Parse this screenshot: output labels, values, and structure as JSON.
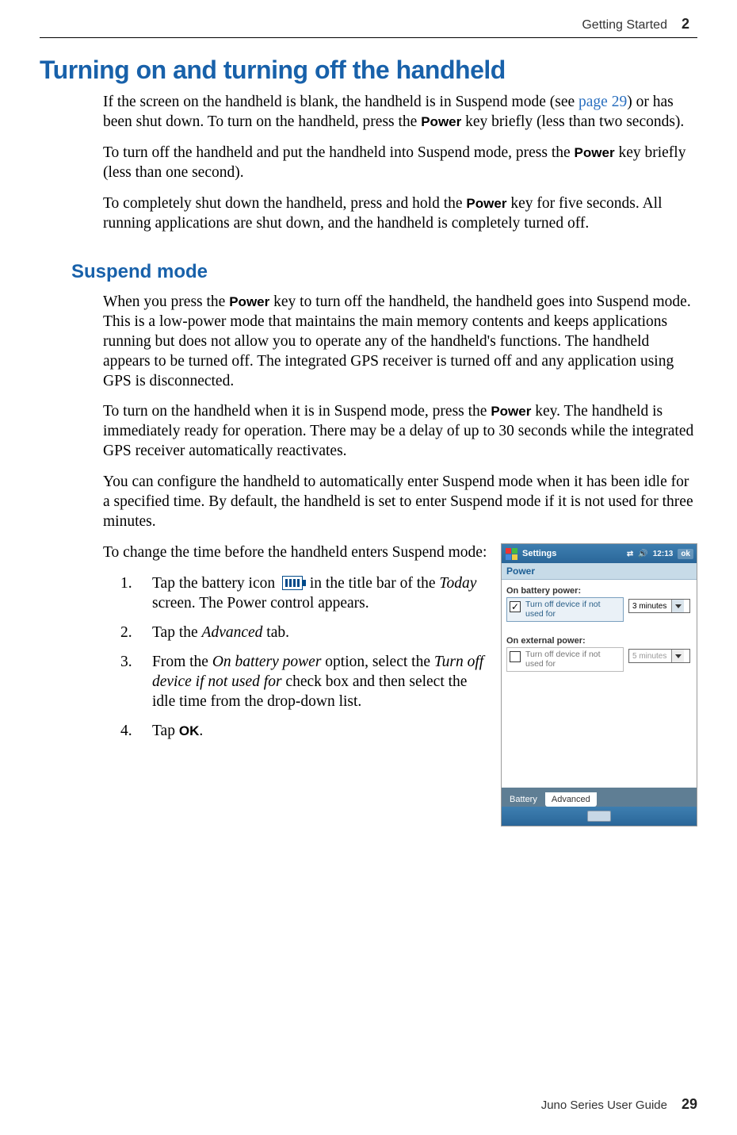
{
  "header": {
    "section": "Getting Started",
    "chapter": "2"
  },
  "h1": "Turning on and turning off the handheld",
  "para1": {
    "t1": "If the screen on the handheld is blank, the handheld is in Suspend mode (see ",
    "link": "page 29",
    "t2": ") or has been shut down. To turn on the handheld, press the ",
    "b1": "Power",
    "t3": " key briefly (less than two seconds)."
  },
  "para2": {
    "t1": "To turn off the handheld and put the handheld into Suspend mode, press the ",
    "b1": "Power",
    "t2": " key briefly (less than one second)."
  },
  "para3": {
    "t1": "To completely shut down the handheld, press and hold the ",
    "b1": "Power",
    "t2": " key for five seconds. All running applications are shut down, and the handheld is completely turned off."
  },
  "h2": "Suspend mode",
  "para4": {
    "t1": "When you press the ",
    "b1": "Power",
    "t2": " key to turn off the handheld, the handheld goes into Suspend mode. This is a low-power mode that maintains the main memory contents and keeps applications running but does not allow you to operate any of the handheld's functions. The handheld appears to be turned off. The integrated GPS receiver is turned off and any application using GPS is disconnected."
  },
  "para5": {
    "t1": "To turn on the handheld when it is in Suspend mode, press the ",
    "b1": "Power",
    "t2": " key. The handheld is immediately ready for operation. There may be a delay of up to 30 seconds while the integrated GPS receiver automatically reactivates."
  },
  "para6": "You can configure the handheld to automatically enter Suspend mode when it has been idle for a specified time. By default, the handheld is set to enter Suspend mode if it is not used for three minutes.",
  "para7": "To change the time before the handheld enters Suspend mode:",
  "steps": {
    "s1": {
      "t1": "Tap the battery icon ",
      "t2": " in the title bar of the ",
      "i1": "Today",
      "t3": " screen. The Power control appears."
    },
    "s2": {
      "t1": "Tap the ",
      "i1": "Advanced",
      "t2": " tab."
    },
    "s3": {
      "t1": "From the ",
      "i1": "On battery power",
      "t2": " option, select the ",
      "i2": "Turn off device if not used for",
      "t3": " check box and then select the idle time from the drop-down list."
    },
    "s4": {
      "t1": "Tap ",
      "b1": "OK",
      "t2": "."
    }
  },
  "figure": {
    "title": "Settings",
    "time": "12:13",
    "ok": "ok",
    "subtitle": "Power",
    "group1": {
      "label": "On battery power:",
      "row": "Turn off device if not used for",
      "dd": "3 minutes",
      "checked": "✓"
    },
    "group2": {
      "label": "On external power:",
      "row": "Turn off device if not used for",
      "dd": "5 minutes",
      "checked": ""
    },
    "tabs": {
      "t1": "Battery",
      "t2": "Advanced"
    }
  },
  "footer": {
    "text": "Juno Series User Guide",
    "page": "29"
  }
}
